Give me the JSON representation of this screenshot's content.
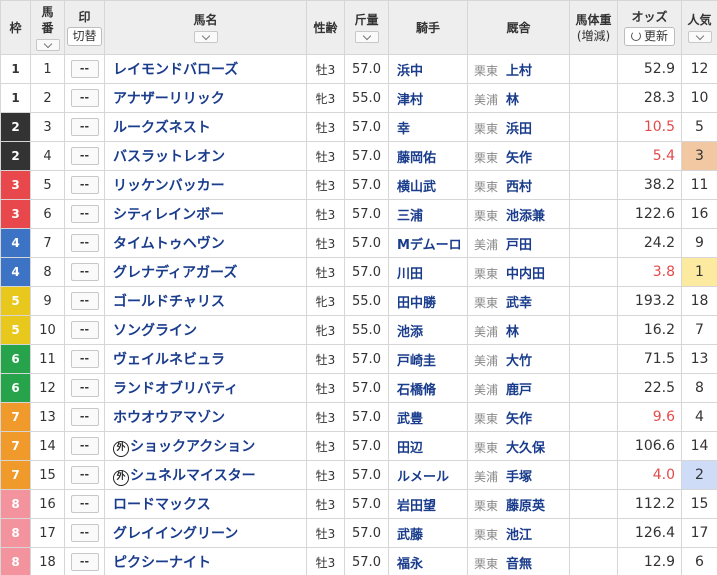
{
  "header": {
    "waku": "枠",
    "umaban_line1": "馬",
    "umaban_line2": "番",
    "mark": "印",
    "mark_toggle": "切替",
    "name": "馬名",
    "sex_age": "性齢",
    "weight": "斤量",
    "jockey": "騎手",
    "stable": "厩舎",
    "body_weight_line1": "馬体重",
    "body_weight_line2": "(増減)",
    "odds": "オッズ",
    "refresh": "更新",
    "pop_line1": "人気"
  },
  "mark_placeholder": "--",
  "foreign_badge": "外",
  "colors": {
    "waku_1": "#ffffff",
    "waku_2": "#333333",
    "waku_3": "#e8474b",
    "waku_4": "#3c73c5",
    "waku_5": "#e8c81c",
    "waku_6": "#27a34b",
    "waku_7": "#f09a2b",
    "waku_8": "#f3939e",
    "name_link": "#1a3c8c",
    "hot_odds": "#e24b4b",
    "pop1": "#fbeaa0",
    "pop2": "#cfdcf7",
    "pop3": "#f2c8a2"
  },
  "horses": [
    {
      "waku": "1",
      "umaban": "1",
      "name": "レイモンドバローズ",
      "foreign": false,
      "sex_age": "牡3",
      "weight": "57.0",
      "jockey": "浜中",
      "loc": "栗東",
      "trainer": "上村",
      "odds": "52.9",
      "pop": "12"
    },
    {
      "waku": "1",
      "umaban": "2",
      "name": "アナザーリリック",
      "foreign": false,
      "sex_age": "牝3",
      "weight": "55.0",
      "jockey": "津村",
      "loc": "美浦",
      "trainer": "林",
      "odds": "28.3",
      "pop": "10"
    },
    {
      "waku": "2",
      "umaban": "3",
      "name": "ルークズネスト",
      "foreign": false,
      "sex_age": "牡3",
      "weight": "57.0",
      "jockey": "幸",
      "loc": "栗東",
      "trainer": "浜田",
      "odds": "10.5",
      "pop": "5"
    },
    {
      "waku": "2",
      "umaban": "4",
      "name": "バスラットレオン",
      "foreign": false,
      "sex_age": "牡3",
      "weight": "57.0",
      "jockey": "藤岡佑",
      "loc": "栗東",
      "trainer": "矢作",
      "odds": "5.4",
      "pop": "3"
    },
    {
      "waku": "3",
      "umaban": "5",
      "name": "リッケンバッカー",
      "foreign": false,
      "sex_age": "牡3",
      "weight": "57.0",
      "jockey": "横山武",
      "loc": "栗東",
      "trainer": "西村",
      "odds": "38.2",
      "pop": "11"
    },
    {
      "waku": "3",
      "umaban": "6",
      "name": "シティレインボー",
      "foreign": false,
      "sex_age": "牡3",
      "weight": "57.0",
      "jockey": "三浦",
      "loc": "栗東",
      "trainer": "池添兼",
      "odds": "122.6",
      "pop": "16"
    },
    {
      "waku": "4",
      "umaban": "7",
      "name": "タイムトゥヘヴン",
      "foreign": false,
      "sex_age": "牡3",
      "weight": "57.0",
      "jockey": "Mデムーロ",
      "loc": "美浦",
      "trainer": "戸田",
      "odds": "24.2",
      "pop": "9"
    },
    {
      "waku": "4",
      "umaban": "8",
      "name": "グレナディアガーズ",
      "foreign": false,
      "sex_age": "牡3",
      "weight": "57.0",
      "jockey": "川田",
      "loc": "栗東",
      "trainer": "中内田",
      "odds": "3.8",
      "pop": "1"
    },
    {
      "waku": "5",
      "umaban": "9",
      "name": "ゴールドチャリス",
      "foreign": false,
      "sex_age": "牝3",
      "weight": "55.0",
      "jockey": "田中勝",
      "loc": "栗東",
      "trainer": "武幸",
      "odds": "193.2",
      "pop": "18"
    },
    {
      "waku": "5",
      "umaban": "10",
      "name": "ソングライン",
      "foreign": false,
      "sex_age": "牝3",
      "weight": "55.0",
      "jockey": "池添",
      "loc": "美浦",
      "trainer": "林",
      "odds": "16.2",
      "pop": "7"
    },
    {
      "waku": "6",
      "umaban": "11",
      "name": "ヴェイルネビュラ",
      "foreign": false,
      "sex_age": "牡3",
      "weight": "57.0",
      "jockey": "戸崎圭",
      "loc": "美浦",
      "trainer": "大竹",
      "odds": "71.5",
      "pop": "13"
    },
    {
      "waku": "6",
      "umaban": "12",
      "name": "ランドオブリバティ",
      "foreign": false,
      "sex_age": "牡3",
      "weight": "57.0",
      "jockey": "石橋脩",
      "loc": "美浦",
      "trainer": "鹿戸",
      "odds": "22.5",
      "pop": "8"
    },
    {
      "waku": "7",
      "umaban": "13",
      "name": "ホウオウアマゾン",
      "foreign": false,
      "sex_age": "牡3",
      "weight": "57.0",
      "jockey": "武豊",
      "loc": "栗東",
      "trainer": "矢作",
      "odds": "9.6",
      "pop": "4"
    },
    {
      "waku": "7",
      "umaban": "14",
      "name": "ショックアクション",
      "foreign": true,
      "sex_age": "牡3",
      "weight": "57.0",
      "jockey": "田辺",
      "loc": "栗東",
      "trainer": "大久保",
      "odds": "106.6",
      "pop": "14"
    },
    {
      "waku": "7",
      "umaban": "15",
      "name": "シュネルマイスター",
      "foreign": true,
      "sex_age": "牡3",
      "weight": "57.0",
      "jockey": "ルメール",
      "loc": "美浦",
      "trainer": "手塚",
      "odds": "4.0",
      "pop": "2"
    },
    {
      "waku": "8",
      "umaban": "16",
      "name": "ロードマックス",
      "foreign": false,
      "sex_age": "牡3",
      "weight": "57.0",
      "jockey": "岩田望",
      "loc": "栗東",
      "trainer": "藤原英",
      "odds": "112.2",
      "pop": "15"
    },
    {
      "waku": "8",
      "umaban": "17",
      "name": "グレイイングリーン",
      "foreign": false,
      "sex_age": "牡3",
      "weight": "57.0",
      "jockey": "武藤",
      "loc": "栗東",
      "trainer": "池江",
      "odds": "126.4",
      "pop": "17"
    },
    {
      "waku": "8",
      "umaban": "18",
      "name": "ピクシーナイト",
      "foreign": false,
      "sex_age": "牡3",
      "weight": "57.0",
      "jockey": "福永",
      "loc": "栗東",
      "trainer": "音無",
      "odds": "12.9",
      "pop": "6"
    }
  ]
}
